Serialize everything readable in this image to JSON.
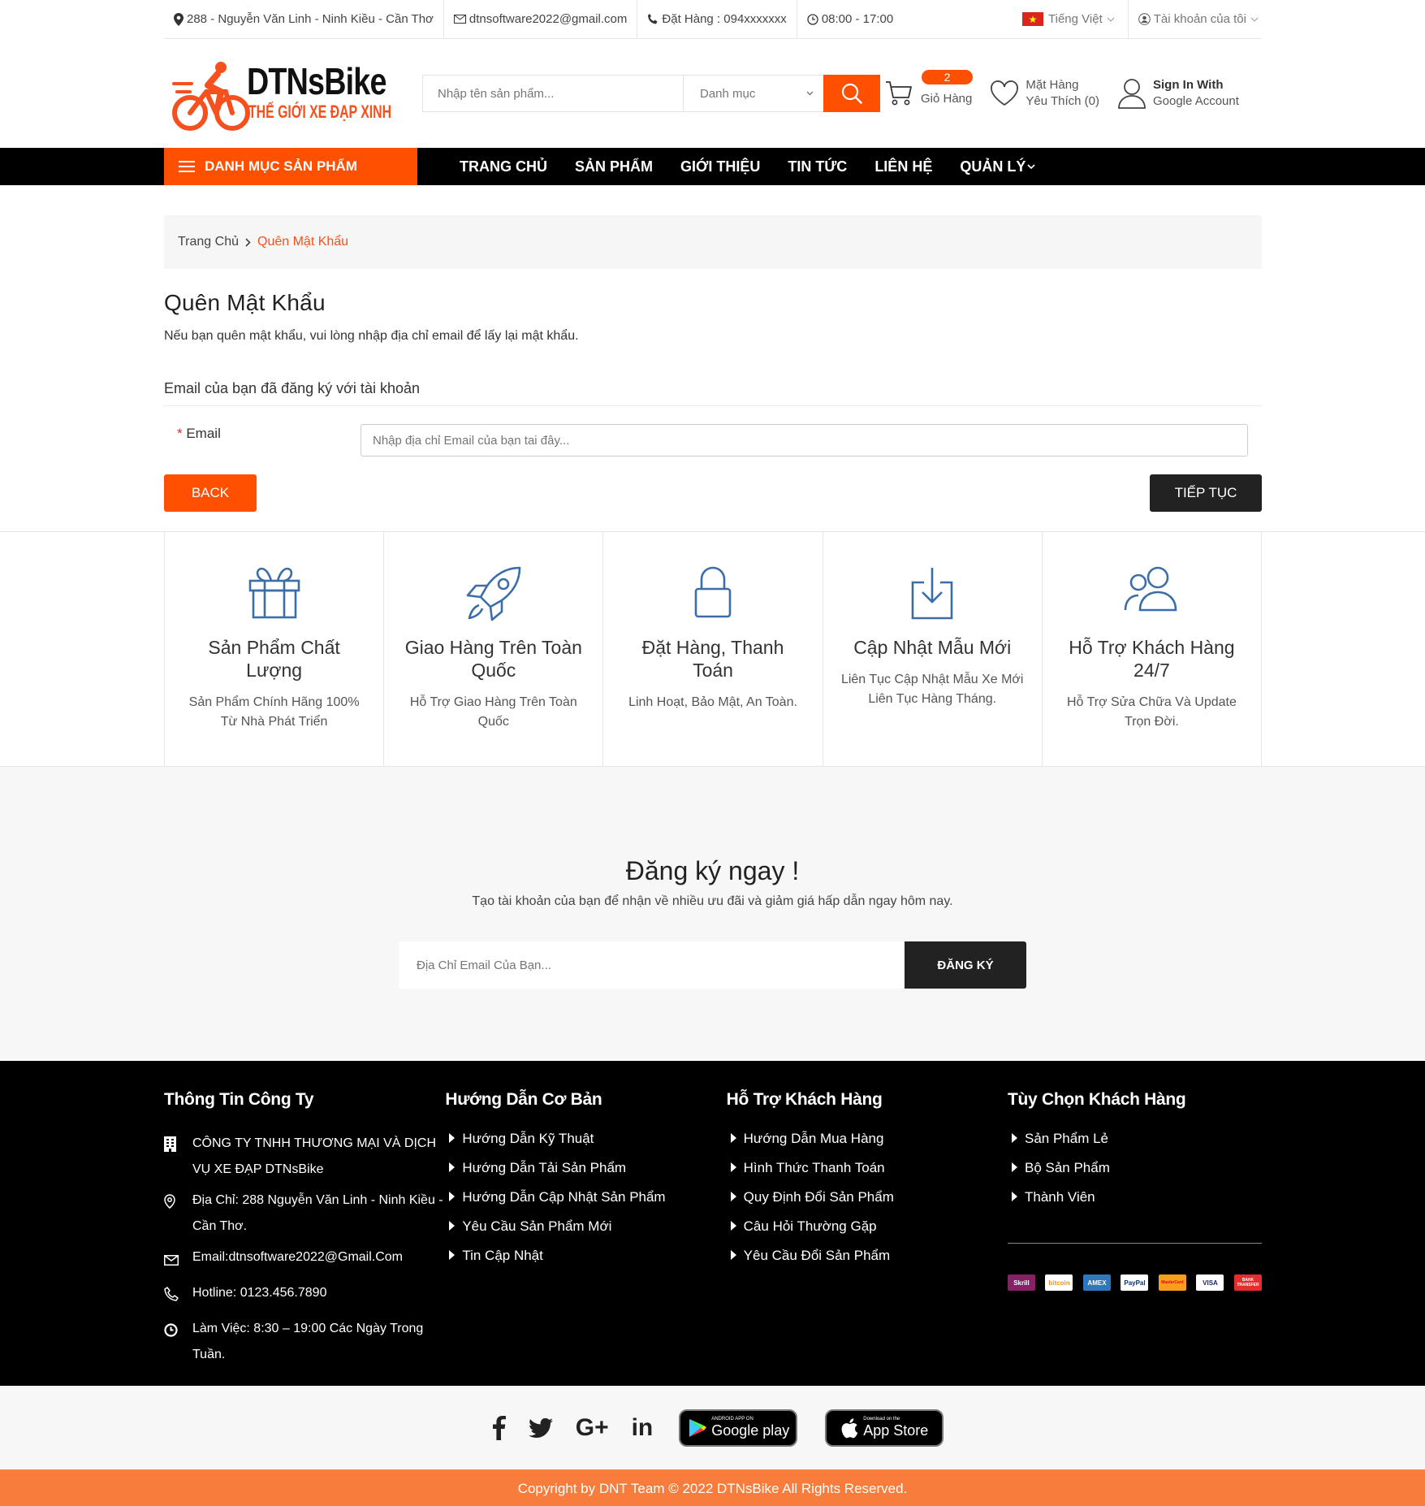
{
  "topbar": {
    "address": "288 - Nguyễn Văn Linh - Ninh Kiều - Cần Thơ",
    "email": "dtnsoftware2022@gmail.com",
    "phone": "Đặt Hàng : 094xxxxxxx",
    "hours": "08:00 - 17:00",
    "language": "Tiếng Việt",
    "account": "Tài khoản của tôi"
  },
  "logo": {
    "brand": "DTNsBike",
    "slogan": "THẾ GIỚI XE ĐẠP XINH"
  },
  "search": {
    "placeholder": "Nhập tên sản phẩm...",
    "category": "Danh mục"
  },
  "cart": {
    "count": "2",
    "label": "Giỏ Hàng"
  },
  "wishlist": {
    "line1": "Mặt Hàng",
    "line2": "Yêu Thích (0)"
  },
  "signin": {
    "line1": "Sign In With",
    "line2": "Google Account"
  },
  "nav": {
    "category_button": "DANH MỤC SẢN PHẨM",
    "items": [
      "TRANG CHỦ",
      "SẢN PHẨM",
      "GIỚI THIỆU",
      "TIN TỨC",
      "LIÊN HỆ",
      "QUẢN LÝ"
    ]
  },
  "breadcrumb": {
    "home": "Trang Chủ",
    "current": "Quên Mật Khẩu"
  },
  "page": {
    "title": "Quên Mật Khẩu",
    "description": "Nếu bạn quên mật khẩu, vui lòng nhập địa chỉ email để lấy lại mật khẩu.",
    "legend": "Email của bạn đã đăng ký với tài khoản",
    "email_label": "Email",
    "email_placeholder": "Nhập địa chỉ Email của bạn tai đây...",
    "back_label": "BACK",
    "next_label": "TIẾP TỤC"
  },
  "features": [
    {
      "icon": "gift-icon",
      "title": "Sản Phẩm Chất Lượng",
      "desc": "Sản Phẩm Chính Hãng 100% Từ Nhà Phát Triển"
    },
    {
      "icon": "rocket-icon",
      "title": "Giao Hàng Trên Toàn Quốc",
      "desc": "Hỗ Trợ Giao Hàng Trên Toàn Quốc"
    },
    {
      "icon": "lock-icon",
      "title": "Đặt Hàng, Thanh Toán",
      "desc": "Linh Hoạt, Bảo Mật, An Toàn."
    },
    {
      "icon": "download-icon",
      "title": "Cập Nhật Mẫu Mới",
      "desc": "Liên Tục Cập Nhật Mẫu Xe Mới Liên Tục Hàng Tháng."
    },
    {
      "icon": "users-icon",
      "title": "Hỗ Trợ Khách Hàng 24/7",
      "desc": "Hỗ Trợ Sửa Chữa Và Update Trọn Đời."
    }
  ],
  "newsletter": {
    "title": "Đăng ký ngay !",
    "subtitle": "Tạo tài khoản của bạn để nhận về nhiều ưu đãi và giảm giá hấp dẫn ngay hôm nay.",
    "placeholder": "Địa Chỉ Email Của Bạn...",
    "button": "ĐĂNG KÝ"
  },
  "footer": {
    "company": {
      "title": "Thông Tin Công Ty",
      "name": "CÔNG TY TNHH THƯƠNG MẠI VÀ DỊCH VỤ XE ĐẠP DTNsBike",
      "address": "Địa Chỉ: 288 Nguyễn Văn Linh - Ninh Kiều - Cần Thơ.",
      "email": "Email:dtnsoftware2022@Gmail.Com",
      "hotline": "Hotline: 0123.456.7890",
      "hours": "Làm Việc: 8:30 – 19:00 Các Ngày Trong Tuần."
    },
    "guide": {
      "title": "Hướng Dẫn Cơ Bản",
      "links": [
        "Hướng Dẫn Kỹ Thuật",
        "Hướng Dẫn Tải Sản Phẩm",
        "Hướng Dẫn Cập Nhật Sản Phẩm",
        "Yêu Cầu Sản Phẩm Mới",
        "Tin Cập Nhật"
      ]
    },
    "support": {
      "title": "Hỗ Trợ Khách Hàng",
      "links": [
        "Hướng Dẫn Mua Hàng",
        "Hình Thức Thanh Toán",
        "Quy Định Đổi Sản Phẩm",
        "Câu Hỏi Thường Gặp",
        "Yêu Cầu Đổi Sản Phẩm"
      ]
    },
    "options": {
      "title": "Tùy Chọn Khách Hàng",
      "links": [
        "Sản Phẩm Lẻ",
        "Bộ Sản Phẩm",
        "Thành Viên"
      ]
    },
    "payments": [
      "Skrill",
      "bitcoin",
      "AMEX",
      "PayPal",
      "MasterCard",
      "VISA",
      "BANK TRANSFER"
    ]
  },
  "social": {
    "google_play_small": "ANDROID APP ON",
    "google_play": "Google play",
    "app_store_small": "Download on the",
    "app_store": "App Store"
  },
  "copyright": "Copyright by DNT Team © 2022 DTNsBike All Rights Reserved.",
  "colors": {
    "accent": "#fe5000",
    "dark": "#000000",
    "icon_blue": "#3b6ea8",
    "copyright_bar": "#f87c3b"
  }
}
